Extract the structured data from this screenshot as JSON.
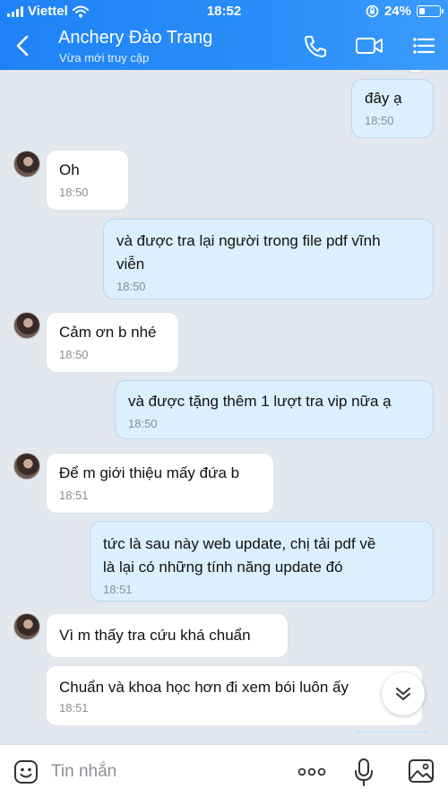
{
  "status": {
    "carrier": "Viettel",
    "time": "18:52",
    "battery": "24%"
  },
  "header": {
    "name": "Anchery Đào Trang",
    "status": "Vừa mới truy cập"
  },
  "messages": [
    {
      "dir": "out",
      "text": "đây ạ",
      "time": "18:50"
    },
    {
      "dir": "in",
      "text": "Oh",
      "time": "18:50"
    },
    {
      "dir": "out",
      "text": "và được tra lại người trong file pdf vĩnh\nviễn",
      "time": "18:50"
    },
    {
      "dir": "in",
      "text": "Cảm ơn b nhé",
      "time": "18:50"
    },
    {
      "dir": "out",
      "text": "và được tặng thêm 1 lượt tra vip nữa ạ",
      "time": "18:50"
    },
    {
      "dir": "in",
      "text": "Để m giới thiệu mấy đứa b",
      "time": "18:51"
    },
    {
      "dir": "out",
      "text": "tức là sau này web update, chị tải pdf về\nlà lại có những tính năng update đó",
      "time": "18:51"
    },
    {
      "dir": "in",
      "text": "Vì m thấy tra cứu khá chuẩn",
      "time": ""
    },
    {
      "dir": "in",
      "text": "Chuẩn và khoa học hơn đi xem bói luôn ấy",
      "time": "18:51"
    }
  ],
  "input": {
    "placeholder": "Tin nhắn"
  },
  "colors": {
    "header": "#2a8ef9",
    "bubble_out": "#dbeffd",
    "bubble_in": "#ffffff",
    "background": "#e3e7ee"
  },
  "icons": [
    "back-icon",
    "phone-icon",
    "video-camera-icon",
    "menu-list-icon",
    "chevron-double-down-icon",
    "emoji-icon",
    "more-icon",
    "microphone-icon",
    "image-icon"
  ]
}
